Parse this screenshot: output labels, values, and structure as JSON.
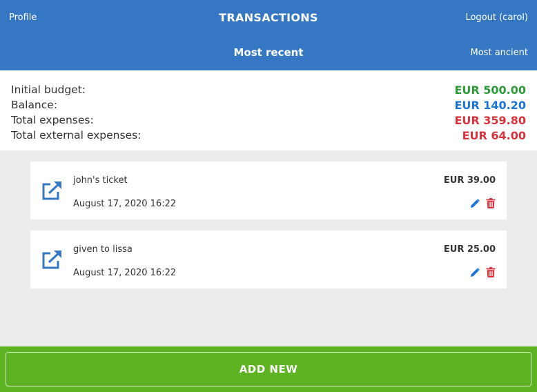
{
  "header": {
    "profile_label": "Profile",
    "title": "TRANSACTIONS",
    "logout_label": "Logout (carol)",
    "sort_recent_label": "Most recent",
    "sort_ancient_label": "Most ancient"
  },
  "summary": {
    "initial_budget": {
      "label": "Initial budget:",
      "value": "EUR 500.00",
      "color": "#2e9a3a"
    },
    "balance": {
      "label": "Balance:",
      "value": "EUR 140.20",
      "color": "#1b74d6"
    },
    "total_expenses": {
      "label": "Total expenses:",
      "value": "EUR 359.80",
      "color": "#d9323d"
    },
    "total_external_expenses": {
      "label": "Total external expenses:",
      "value": "EUR 64.00",
      "color": "#d9323d"
    }
  },
  "transactions": [
    {
      "description": "john's ticket",
      "amount": "EUR 39.00",
      "date": "August 17, 2020 16:22",
      "icon": "external-link-icon"
    },
    {
      "description": "given to lissa",
      "amount": "EUR 25.00",
      "date": "August 17, 2020 16:22",
      "icon": "external-link-icon"
    }
  ],
  "footer": {
    "add_label": "ADD NEW"
  },
  "colors": {
    "header_bg": "#3577c2",
    "footer_bg": "#5db322",
    "edit_icon": "#1b74d6",
    "delete_icon": "#d9323d"
  }
}
